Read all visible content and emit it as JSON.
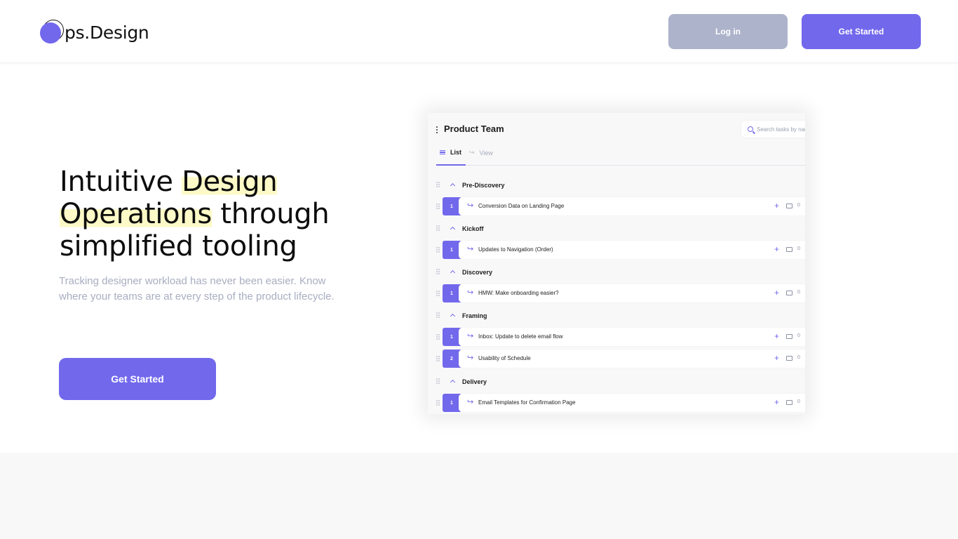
{
  "header": {
    "logo_text": "ps.Design",
    "login_label": "Log in",
    "get_started_label": "Get Started"
  },
  "hero": {
    "title_part1": "Intuitive ",
    "title_highlight1": "Design",
    "title_highlight2": "Operations",
    "title_part2": " through",
    "title_part3": "simplified tooling",
    "subtitle": "Tracking designer workload has never been easier. Know where your teams are at every step of the product lifecycle.",
    "cta_label": "Get Started"
  },
  "preview": {
    "team_title": "Product Team",
    "search_placeholder": "Search tasks by name",
    "tabs": [
      {
        "label": "List",
        "active": true
      },
      {
        "label": "View",
        "active": false
      }
    ],
    "groups": [
      {
        "label": "Pre-Discovery",
        "tasks": [
          {
            "num": "1",
            "name": "Conversion Data on Landing Page",
            "comments": "0"
          }
        ]
      },
      {
        "label": "Kickoff",
        "tasks": [
          {
            "num": "1",
            "name": "Updates to Navigation (Order)",
            "comments": "0"
          }
        ]
      },
      {
        "label": "Discovery",
        "tasks": [
          {
            "num": "1",
            "name": "HMW: Make onboarding easier?",
            "comments": "0"
          }
        ]
      },
      {
        "label": "Framing",
        "tasks": [
          {
            "num": "1",
            "name": "Inbox: Update to delete email flow",
            "comments": "0"
          },
          {
            "num": "2",
            "name": "Usability of Schedule",
            "comments": "0"
          }
        ]
      },
      {
        "label": "Delivery",
        "tasks": [
          {
            "num": "1",
            "name": "Email Templates for Confirmation Page",
            "comments": "0"
          }
        ]
      }
    ]
  },
  "colors": {
    "accent": "#7268ec",
    "login_bg": "#adb3cb",
    "highlight": "#fdfac8",
    "subtitle": "#a9adc0"
  },
  "icons": [
    "logo-mark-icon",
    "kebab-menu-icon",
    "search-icon",
    "list-icon",
    "view-icon",
    "drag-handle-icon",
    "chevron-up-icon",
    "redirect-arrow-icon",
    "plus-icon",
    "comment-icon"
  ]
}
